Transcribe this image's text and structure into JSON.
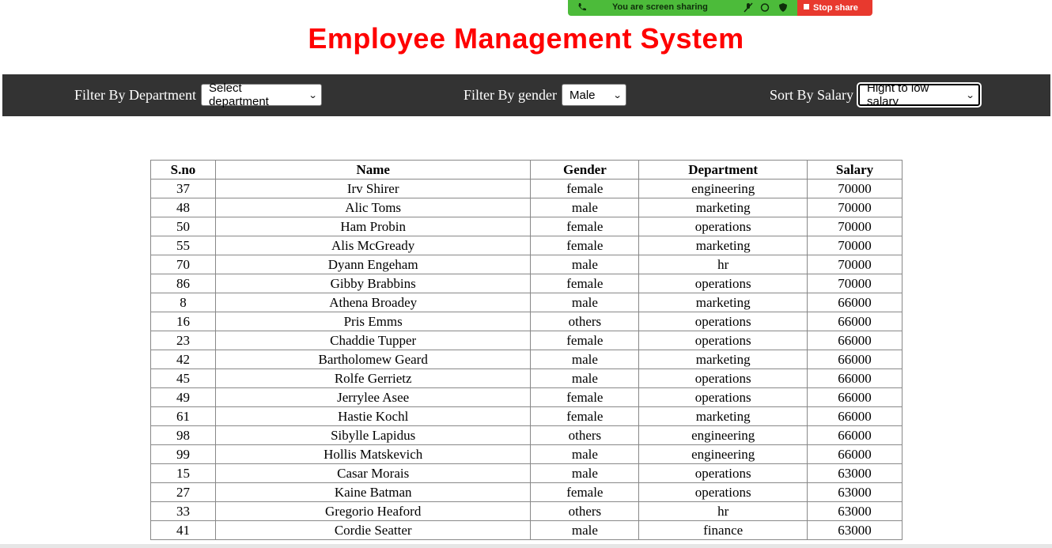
{
  "share_bar": {
    "text": "You are screen sharing",
    "stop_label": "Stop share"
  },
  "title": "Employee Management System",
  "filters": {
    "department_label": "Filter By Department",
    "department_value": "Select department",
    "gender_label": "Filter By gender",
    "gender_value": "Male",
    "salary_label": "Sort By Salary",
    "salary_value": "Hight to low salary"
  },
  "table": {
    "headers": [
      "S.no",
      "Name",
      "Gender",
      "Department",
      "Salary"
    ],
    "rows": [
      [
        "37",
        "Irv Shirer",
        "female",
        "engineering",
        "70000"
      ],
      [
        "48",
        "Alic Toms",
        "male",
        "marketing",
        "70000"
      ],
      [
        "50",
        "Ham Probin",
        "female",
        "operations",
        "70000"
      ],
      [
        "55",
        "Alis McGready",
        "female",
        "marketing",
        "70000"
      ],
      [
        "70",
        "Dyann Engeham",
        "male",
        "hr",
        "70000"
      ],
      [
        "86",
        "Gibby Brabbins",
        "female",
        "operations",
        "70000"
      ],
      [
        "8",
        "Athena Broadey",
        "male",
        "marketing",
        "66000"
      ],
      [
        "16",
        "Pris Emms",
        "others",
        "operations",
        "66000"
      ],
      [
        "23",
        "Chaddie Tupper",
        "female",
        "operations",
        "66000"
      ],
      [
        "42",
        "Bartholomew Geard",
        "male",
        "marketing",
        "66000"
      ],
      [
        "45",
        "Rolfe Gerrietz",
        "male",
        "operations",
        "66000"
      ],
      [
        "49",
        "Jerrylee Asee",
        "female",
        "operations",
        "66000"
      ],
      [
        "61",
        "Hastie Kochl",
        "female",
        "marketing",
        "66000"
      ],
      [
        "98",
        "Sibylle Lapidus",
        "others",
        "engineering",
        "66000"
      ],
      [
        "99",
        "Hollis Matskevich",
        "male",
        "engineering",
        "66000"
      ],
      [
        "15",
        "Casar Morais",
        "male",
        "operations",
        "63000"
      ],
      [
        "27",
        "Kaine Batman",
        "female",
        "operations",
        "63000"
      ],
      [
        "33",
        "Gregorio Heaford",
        "others",
        "hr",
        "63000"
      ],
      [
        "41",
        "Cordie Seatter",
        "male",
        "finance",
        "63000"
      ]
    ]
  },
  "icons": {
    "chevron": "chevron-down-icon",
    "phone": "phone-icon",
    "mic": "mic-off-icon",
    "shield": "shield-icon"
  },
  "colors": {
    "title": "#ff0000",
    "filter_bar": "#333333",
    "share_green": "#4cbb3a",
    "share_red": "#e8392e"
  }
}
